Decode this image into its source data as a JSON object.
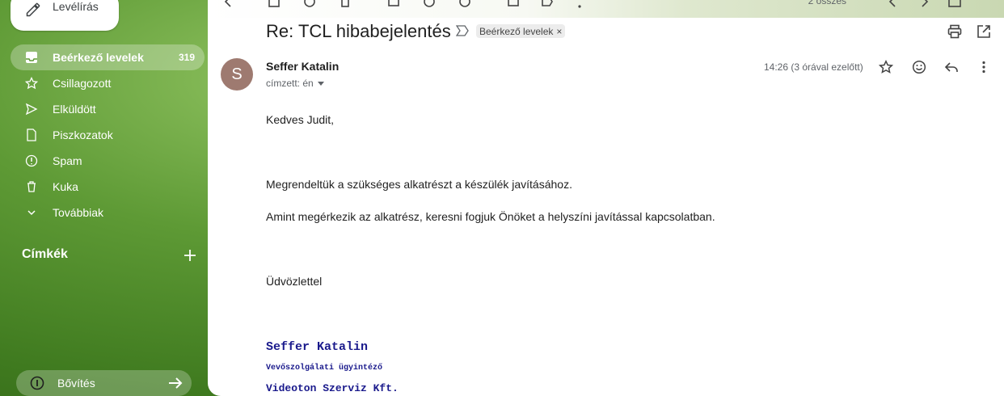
{
  "sidebar": {
    "compose_label": "Levélírás",
    "items": [
      {
        "label": "Beérkező levelek",
        "count": "319",
        "icon": "inbox-icon"
      },
      {
        "label": "Csillagozott",
        "icon": "star-icon"
      },
      {
        "label": "Elküldött",
        "icon": "send-icon"
      },
      {
        "label": "Piszkozatok",
        "icon": "draft-icon"
      },
      {
        "label": "Spam",
        "icon": "spam-icon"
      },
      {
        "label": "Kuka",
        "icon": "trash-icon"
      },
      {
        "label": "Továbbiak",
        "icon": "chevron-down-icon"
      }
    ],
    "labels_heading": "Címkék",
    "upgrade_label": "Bővítés"
  },
  "toolbar": {
    "page_count": "2 összes"
  },
  "email": {
    "subject": "Re: TCL hibabejelentés",
    "label_chip": "Beérkező levelek",
    "label_chip_remove": "×",
    "avatar_letter": "S",
    "avatar_color": "#9e7a70",
    "sender": "Seffer Katalin",
    "to": "címzett: én",
    "time": "14:26 (3 órával ezelőtt)",
    "body": {
      "greeting": "Kedves Judit,",
      "line1": "Megrendeltük a szükséges alkatrészt a készülék javításához.",
      "line2": "Amint megérkezik az alkatrész, keresni fogjuk Önöket a helyszíni javítással kapcsolatban.",
      "closing": "Üdvözlettel",
      "sig_name": "Seffer Katalin",
      "sig_title": "Vevőszolgálati ügyintéző",
      "sig_company": "Videoton Szerviz Kft."
    }
  },
  "colors": {
    "accent_text": "#1a1a8c",
    "sidebar_bg": "#5e9a35"
  }
}
